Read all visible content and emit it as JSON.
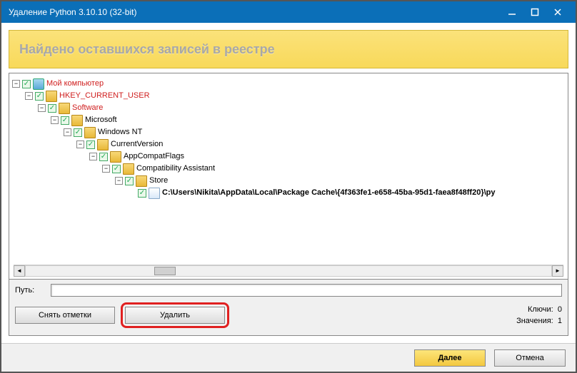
{
  "titlebar": {
    "title": "Удаление Python 3.10.10 (32-bit)"
  },
  "banner": {
    "title": "Найдено оставшихся записей в реестре"
  },
  "tree": {
    "nodes": [
      {
        "indent": 0,
        "label": "Мой компьютер",
        "red": true,
        "icon": "computer"
      },
      {
        "indent": 1,
        "label": "HKEY_CURRENT_USER",
        "red": true,
        "icon": "folder"
      },
      {
        "indent": 2,
        "label": "Software",
        "red": true,
        "icon": "folder"
      },
      {
        "indent": 3,
        "label": "Microsoft",
        "red": false,
        "icon": "folder"
      },
      {
        "indent": 4,
        "label": "Windows NT",
        "red": false,
        "icon": "folder"
      },
      {
        "indent": 5,
        "label": "CurrentVersion",
        "red": false,
        "icon": "folder"
      },
      {
        "indent": 6,
        "label": "AppCompatFlags",
        "red": false,
        "icon": "folder"
      },
      {
        "indent": 7,
        "label": "Compatibility Assistant",
        "red": false,
        "icon": "folder"
      },
      {
        "indent": 8,
        "label": "Store",
        "red": false,
        "icon": "folder"
      },
      {
        "indent": 9,
        "label": "C:\\Users\\Nikita\\AppData\\Local\\Package Cache\\{4f363fe1-e658-45ba-95d1-faea8f48ff20}\\py",
        "red": false,
        "bold": true,
        "icon": "page",
        "leaf": true
      }
    ]
  },
  "path_section": {
    "path_label": "Путь:",
    "uncheck_btn": "Снять отметки",
    "delete_btn": "Удалить",
    "keys_label": "Ключи:",
    "keys_value": "0",
    "values_label": "Значения:",
    "values_value": "1"
  },
  "footer": {
    "next": "Далее",
    "cancel": "Отмена"
  }
}
